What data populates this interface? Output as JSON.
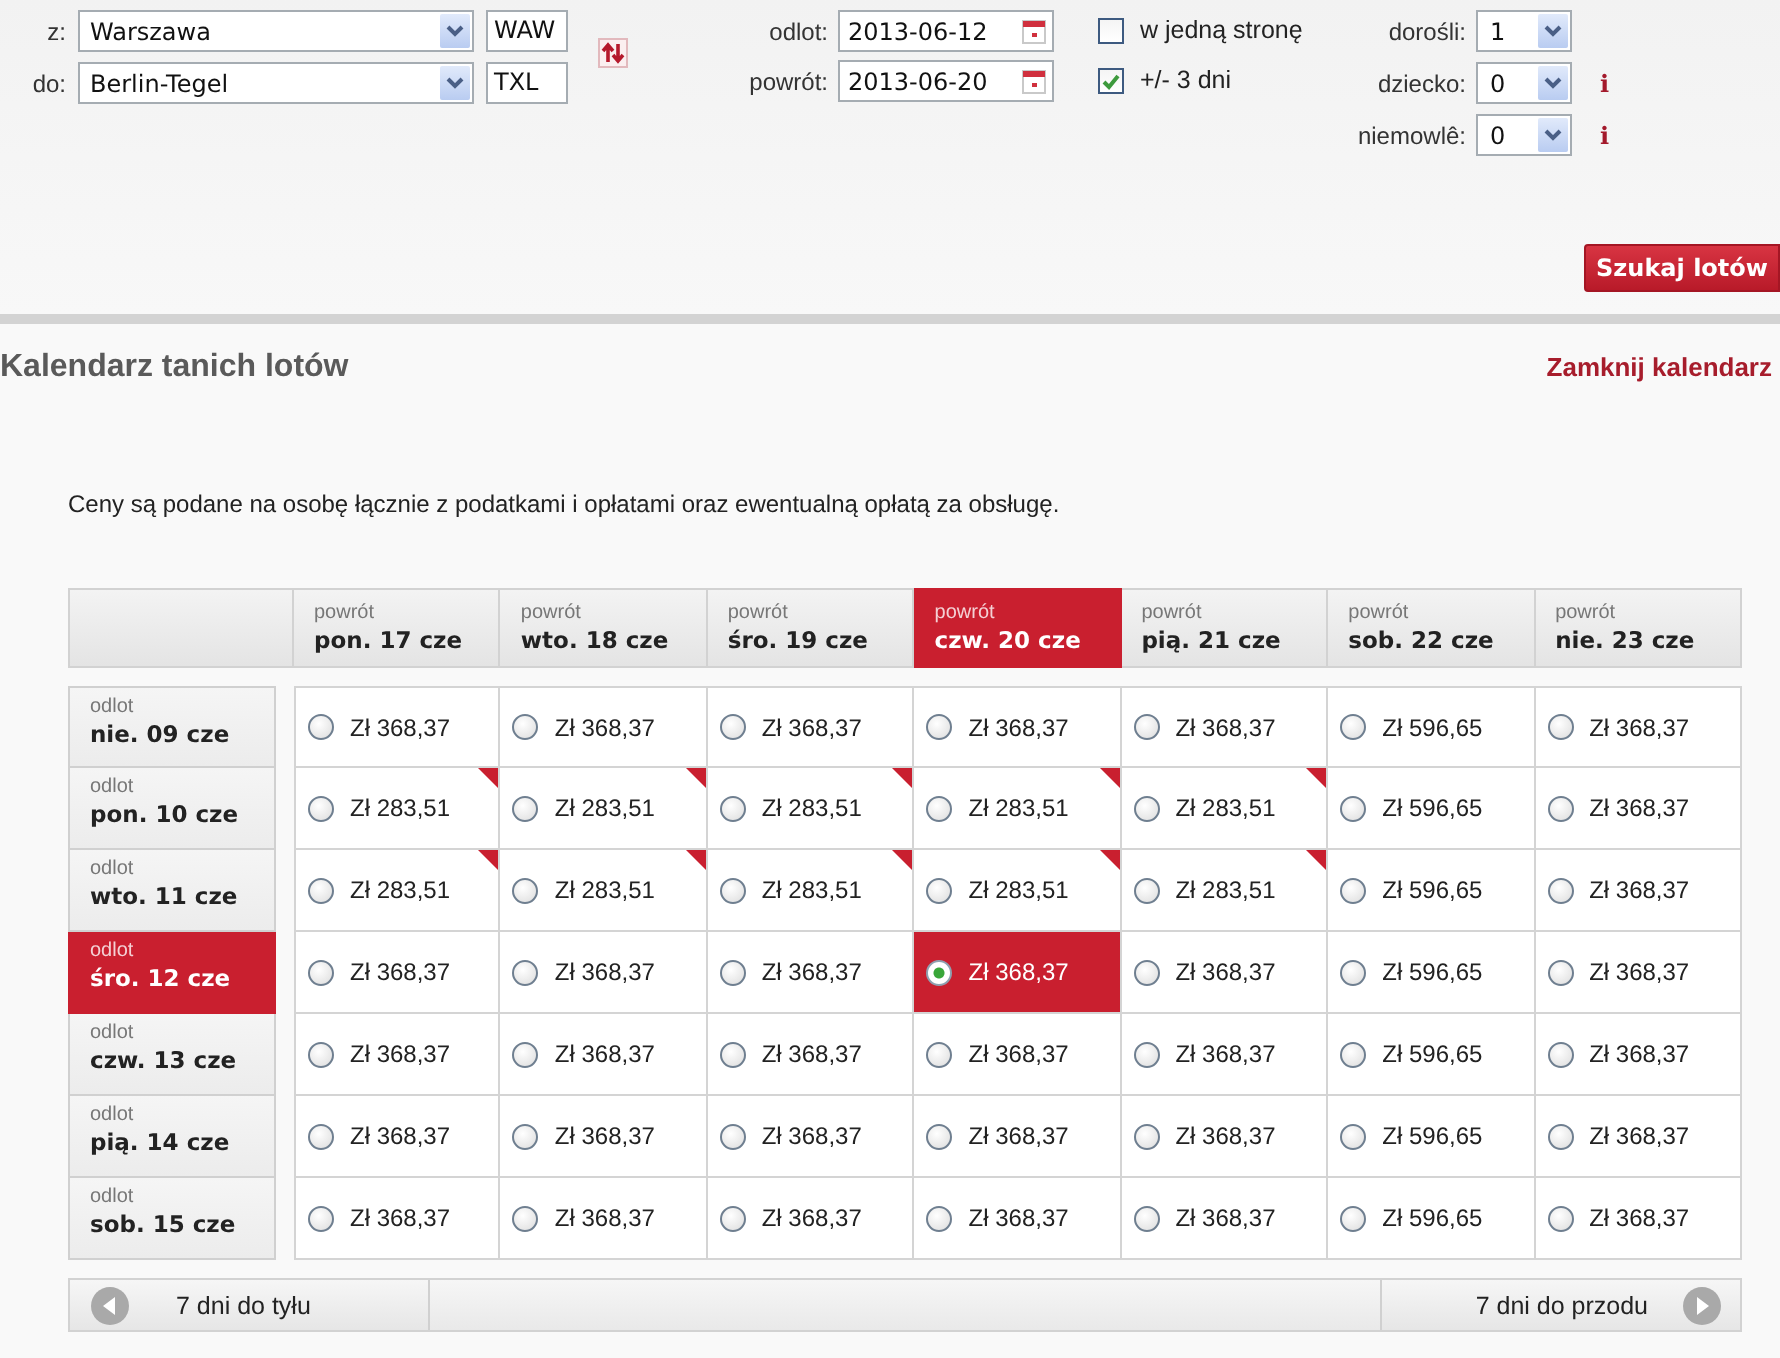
{
  "search_form": {
    "route": [
      {
        "label": "z:",
        "value": "Warszawa",
        "code": "WAW"
      },
      {
        "label": "do:",
        "value": "Berlin-Tegel",
        "code": "TXL"
      }
    ],
    "dates": [
      {
        "label": "odlot:",
        "value": "2013-06-12"
      },
      {
        "label": "powrót:",
        "value": "2013-06-20"
      }
    ],
    "options": [
      {
        "label": "w jedną stronę",
        "checked": false
      },
      {
        "label": "+/- 3 dni",
        "checked": true
      }
    ],
    "passengers": [
      {
        "label": "dorośli:",
        "value": "1"
      },
      {
        "label": "dziecko:",
        "value": "0",
        "info": "i"
      },
      {
        "label": "niemowlê:",
        "value": "0",
        "info": "i"
      }
    ],
    "submit": "Szukaj lotów"
  },
  "calendar": {
    "title": "Kalendarz tanich lotów",
    "close_link": "Zamknij kalendarz",
    "note": "Ceny są podane na osobę łącznie z podatkami i opłatami oraz ewentualną opłatą za obsługę.",
    "columns": [
      {
        "caption": "powrót",
        "day": "pon. 17 cze",
        "selected": false
      },
      {
        "caption": "powrót",
        "day": "wto. 18 cze",
        "selected": false
      },
      {
        "caption": "powrót",
        "day": "śro. 19 cze",
        "selected": false
      },
      {
        "caption": "powrót",
        "day": "czw. 20 cze",
        "selected": true
      },
      {
        "caption": "powrót",
        "day": "pią. 21 cze",
        "selected": false
      },
      {
        "caption": "powrót",
        "day": "sob. 22 cze",
        "selected": false
      },
      {
        "caption": "powrót",
        "day": "nie. 23 cze",
        "selected": false
      }
    ],
    "rows": [
      {
        "caption": "odlot",
        "day": "nie. 09 cze",
        "selected": false,
        "cells": [
          {
            "price": "Zł 368,37",
            "selected": false,
            "flagged": false
          },
          {
            "price": "Zł 368,37",
            "selected": false,
            "flagged": false
          },
          {
            "price": "Zł 368,37",
            "selected": false,
            "flagged": false
          },
          {
            "price": "Zł 368,37",
            "selected": false,
            "flagged": false
          },
          {
            "price": "Zł 368,37",
            "selected": false,
            "flagged": false
          },
          {
            "price": "Zł 596,65",
            "selected": false,
            "flagged": false
          },
          {
            "price": "Zł 368,37",
            "selected": false,
            "flagged": false
          }
        ]
      },
      {
        "caption": "odlot",
        "day": "pon. 10 cze",
        "selected": false,
        "cells": [
          {
            "price": "Zł 283,51",
            "selected": false,
            "flagged": true
          },
          {
            "price": "Zł 283,51",
            "selected": false,
            "flagged": true
          },
          {
            "price": "Zł 283,51",
            "selected": false,
            "flagged": true
          },
          {
            "price": "Zł 283,51",
            "selected": false,
            "flagged": true
          },
          {
            "price": "Zł 283,51",
            "selected": false,
            "flagged": true
          },
          {
            "price": "Zł 596,65",
            "selected": false,
            "flagged": false
          },
          {
            "price": "Zł 368,37",
            "selected": false,
            "flagged": false
          }
        ]
      },
      {
        "caption": "odlot",
        "day": "wto. 11 cze",
        "selected": false,
        "cells": [
          {
            "price": "Zł 283,51",
            "selected": false,
            "flagged": true
          },
          {
            "price": "Zł 283,51",
            "selected": false,
            "flagged": true
          },
          {
            "price": "Zł 283,51",
            "selected": false,
            "flagged": true
          },
          {
            "price": "Zł 283,51",
            "selected": false,
            "flagged": true
          },
          {
            "price": "Zł 283,51",
            "selected": false,
            "flagged": true
          },
          {
            "price": "Zł 596,65",
            "selected": false,
            "flagged": false
          },
          {
            "price": "Zł 368,37",
            "selected": false,
            "flagged": false
          }
        ]
      },
      {
        "caption": "odlot",
        "day": "śro. 12 cze",
        "selected": true,
        "cells": [
          {
            "price": "Zł 368,37",
            "selected": false,
            "flagged": false
          },
          {
            "price": "Zł 368,37",
            "selected": false,
            "flagged": false
          },
          {
            "price": "Zł 368,37",
            "selected": false,
            "flagged": false
          },
          {
            "price": "Zł 368,37",
            "selected": true,
            "flagged": false
          },
          {
            "price": "Zł 368,37",
            "selected": false,
            "flagged": false
          },
          {
            "price": "Zł 596,65",
            "selected": false,
            "flagged": false
          },
          {
            "price": "Zł 368,37",
            "selected": false,
            "flagged": false
          }
        ]
      },
      {
        "caption": "odlot",
        "day": "czw. 13 cze",
        "selected": false,
        "cells": [
          {
            "price": "Zł 368,37",
            "selected": false,
            "flagged": false
          },
          {
            "price": "Zł 368,37",
            "selected": false,
            "flagged": false
          },
          {
            "price": "Zł 368,37",
            "selected": false,
            "flagged": false
          },
          {
            "price": "Zł 368,37",
            "selected": false,
            "flagged": false
          },
          {
            "price": "Zł 368,37",
            "selected": false,
            "flagged": false
          },
          {
            "price": "Zł 596,65",
            "selected": false,
            "flagged": false
          },
          {
            "price": "Zł 368,37",
            "selected": false,
            "flagged": false
          }
        ]
      },
      {
        "caption": "odlot",
        "day": "pią. 14 cze",
        "selected": false,
        "cells": [
          {
            "price": "Zł 368,37",
            "selected": false,
            "flagged": false
          },
          {
            "price": "Zł 368,37",
            "selected": false,
            "flagged": false
          },
          {
            "price": "Zł 368,37",
            "selected": false,
            "flagged": false
          },
          {
            "price": "Zł 368,37",
            "selected": false,
            "flagged": false
          },
          {
            "price": "Zł 368,37",
            "selected": false,
            "flagged": false
          },
          {
            "price": "Zł 596,65",
            "selected": false,
            "flagged": false
          },
          {
            "price": "Zł 368,37",
            "selected": false,
            "flagged": false
          }
        ]
      },
      {
        "caption": "odlot",
        "day": "sob. 15 cze",
        "selected": false,
        "cells": [
          {
            "price": "Zł 368,37",
            "selected": false,
            "flagged": false
          },
          {
            "price": "Zł 368,37",
            "selected": false,
            "flagged": false
          },
          {
            "price": "Zł 368,37",
            "selected": false,
            "flagged": false
          },
          {
            "price": "Zł 368,37",
            "selected": false,
            "flagged": false
          },
          {
            "price": "Zł 368,37",
            "selected": false,
            "flagged": false
          },
          {
            "price": "Zł 596,65",
            "selected": false,
            "flagged": false
          },
          {
            "price": "Zł 368,37",
            "selected": false,
            "flagged": false
          }
        ]
      }
    ],
    "pager": {
      "prev": "7 dni do tyłu",
      "next": "7 dni do przodu"
    }
  }
}
